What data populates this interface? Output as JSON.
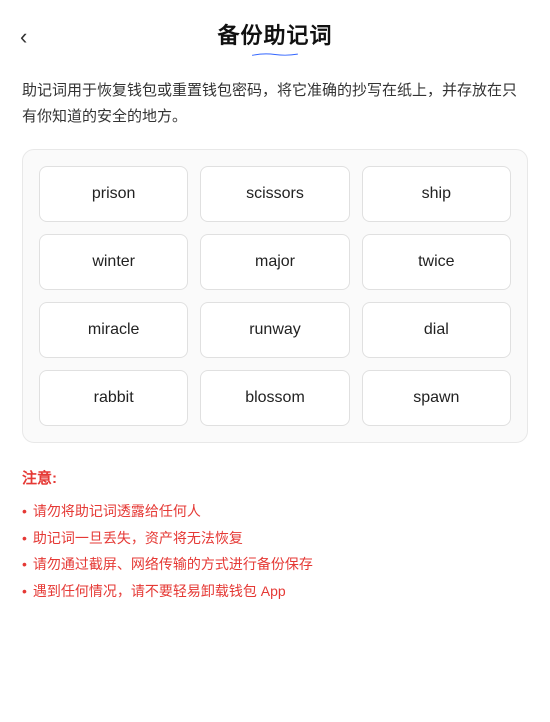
{
  "header": {
    "back_icon": "‹",
    "title": "备份助记词"
  },
  "description": "助记词用于恢复钱包或重置钱包密码，将它准确的抄写在纸上，并存放在只有你知道的安全的地方。",
  "mnemonic_grid": {
    "words": [
      "prison",
      "scissors",
      "ship",
      "winter",
      "major",
      "twice",
      "miracle",
      "runway",
      "dial",
      "rabbit",
      "blossom",
      "spawn"
    ]
  },
  "notice": {
    "title": "注意:",
    "items": [
      "请勿将助记词透露给任何人",
      "助记词一旦丢失，资产将无法恢复",
      "请勿通过截屏、网络传输的方式进行备份保存",
      "遇到任何情况，请不要轻易卸载钱包 App"
    ]
  }
}
